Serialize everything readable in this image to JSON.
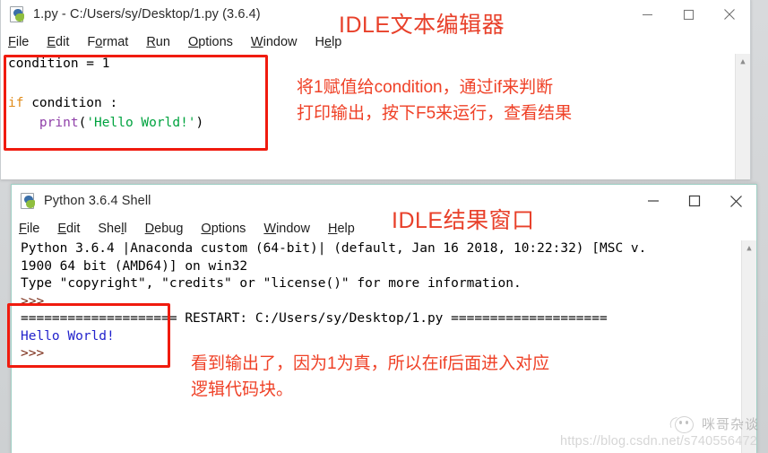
{
  "editor_window": {
    "icon": "python-file-icon",
    "title": "1.py - C:/Users/sy/Desktop/1.py (3.6.4)",
    "menus": [
      "File",
      "Edit",
      "Format",
      "Run",
      "Options",
      "Window",
      "Help"
    ],
    "controls": {
      "minimize": "minimize-icon",
      "maximize": "maximize-icon",
      "close": "close-icon"
    },
    "code": {
      "line1": "condition = 1",
      "line2": "",
      "line3_kw": "if",
      "line3_rest": " condition :",
      "line4_indent": "    ",
      "line4_fn": "print",
      "line4_open": "(",
      "line4_str": "'Hello World!'",
      "line4_close": ")"
    }
  },
  "shell_window": {
    "icon": "python-file-icon",
    "title": "Python 3.6.4 Shell",
    "menus": [
      "File",
      "Edit",
      "Shell",
      "Debug",
      "Options",
      "Window",
      "Help"
    ],
    "controls": {
      "minimize": "minimize-icon",
      "maximize": "maximize-icon",
      "close": "close-icon"
    },
    "output": {
      "banner1": "Python 3.6.4 |Anaconda custom (64-bit)| (default, Jan 16 2018, 10:22:32) [MSC v.",
      "banner2": "1900 64 bit (AMD64)] on win32",
      "banner3": "Type \"copyright\", \"credits\" or \"license()\" for more information.",
      "prompt1": ">>>",
      "restart": "==================== RESTART: C:/Users/sy/Desktop/1.py ====================",
      "hello": "Hello World!",
      "prompt2": ">>>"
    }
  },
  "annotations": {
    "editor_title": "IDLE文本编辑器",
    "editor_note_line1": "将1赋值给condition，通过if来判断",
    "editor_note_line2": "打印输出，按下F5来运行，查看结果",
    "shell_title": "IDLE结果窗口",
    "shell_note_line1": "看到输出了，因为1为真，所以在if后面进入对应",
    "shell_note_line2": "逻辑代码块。"
  },
  "watermark": {
    "logo": "cat-face-logo",
    "name": "咪哥杂谈",
    "url": "https://blog.csdn.net/s740556472"
  },
  "colors": {
    "annotation_red": "#ee3b25",
    "box_red": "#f01b0e",
    "keyword_orange": "#e08b1a",
    "function_purple": "#8f3fa8",
    "string_green": "#00a33f",
    "stdout_blue": "#2222cc",
    "prompt_brown": "#7a2b16",
    "shell_border_teal": "#9fcfc4"
  }
}
